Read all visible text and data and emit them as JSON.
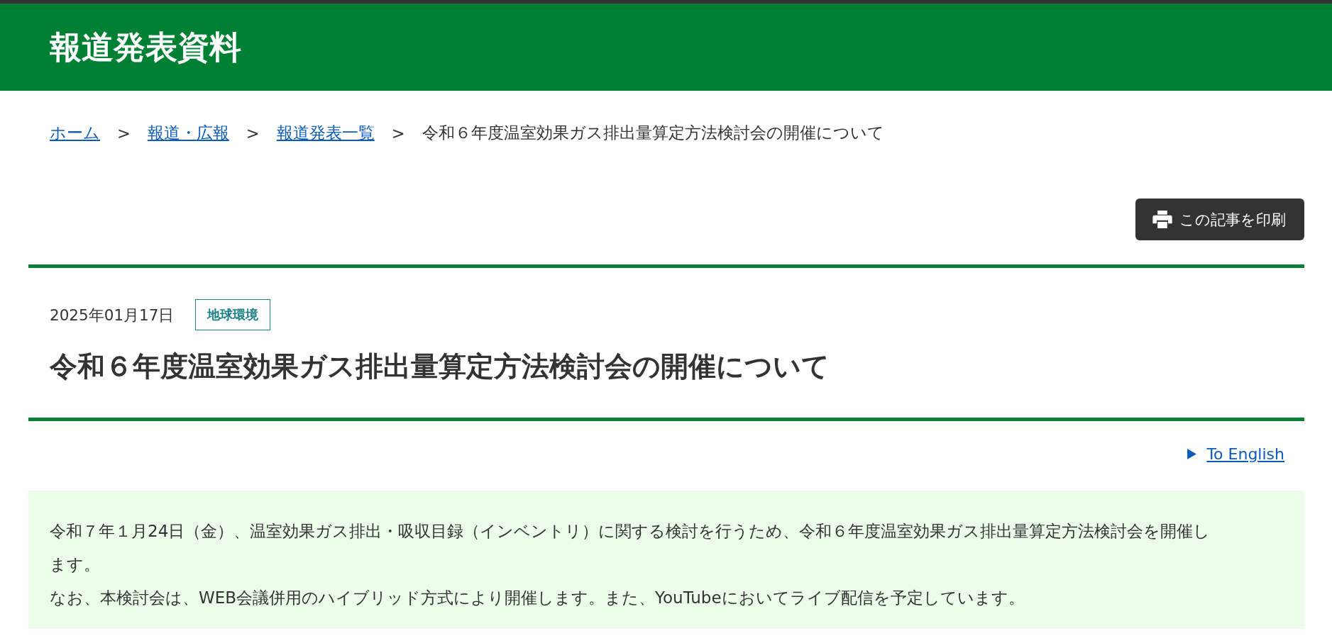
{
  "header": {
    "title": "報道発表資料"
  },
  "breadcrumb": [
    {
      "label": "ホーム",
      "link": true
    },
    {
      "label": "報道・広報",
      "link": true
    },
    {
      "label": "報道発表一覧",
      "link": true
    },
    {
      "label": "令和６年度温室効果ガス排出量算定方法検討会の開催について",
      "link": false
    }
  ],
  "breadcrumb_separator": ">",
  "print_button": {
    "label": "この記事を印刷"
  },
  "article": {
    "date": "2025年01月17日",
    "tag": "地球環境",
    "title": "令和６年度温室効果ガス排出量算定方法検討会の開催について"
  },
  "language_link": {
    "label": "To English"
  },
  "summary": [
    "令和７年１月24日（金）、温室効果ガス排出・吸収目録（インベントリ）に関する検討を行うため、令和６年度温室効果ガス排出量算定方法検討会を開催します。",
    "なお、本検討会は、WEB会議併用のハイブリッド方式により開催します。また、YouTubeにおいてライブ配信を予定しています。"
  ]
}
